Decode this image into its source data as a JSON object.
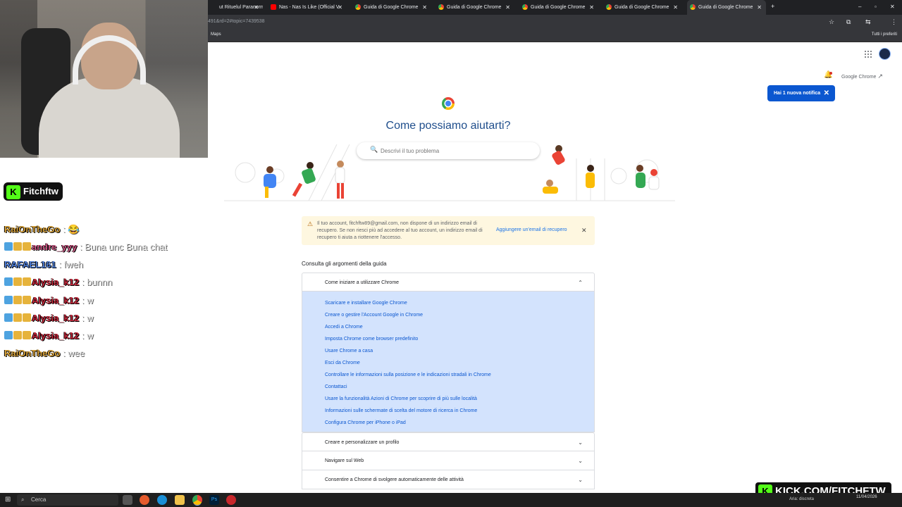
{
  "browser": {
    "tabs": [
      {
        "title": "ut Rituelul Paranormal",
        "favicon": "none"
      },
      {
        "title": "Nas - Nas Is Like (Official V",
        "favicon": "youtube"
      },
      {
        "title": "Guida di Google Chrome",
        "favicon": "google"
      },
      {
        "title": "Guida di Google Chrome",
        "favicon": "google"
      },
      {
        "title": "Guida di Google Chrome",
        "favicon": "google"
      },
      {
        "title": "Guida di Google Chrome",
        "favicon": "google"
      },
      {
        "title": "Guida di Google Chrome",
        "favicon": "google",
        "active": true
      }
    ],
    "url": "491&rd=2#topic=7439538",
    "bookmarks": {
      "left": "Maps",
      "right": "Tutti i preferiti"
    }
  },
  "overlay": {
    "streamer": "Fitchftw",
    "kick_url": "KICK.COM/FITCHFTW",
    "chat": [
      {
        "user": "RaiOnTheGo",
        "msg": "😂",
        "color": "#d8a23a",
        "badges": 0
      },
      {
        "user": "andre_yyy",
        "msg": "Buna unc Buna chat",
        "color": "#d45c8a",
        "badges": 3
      },
      {
        "user": "RAFAEL161",
        "msg": "fweh",
        "color": "#4f7fd9",
        "badges": 0
      },
      {
        "user": "Alysia_k12",
        "msg": "bunnn",
        "color": "#c8283c",
        "badges": 3
      },
      {
        "user": "Alysia_k12",
        "msg": "w",
        "color": "#c8283c",
        "badges": 3
      },
      {
        "user": "Alysia_k12",
        "msg": "w",
        "color": "#c8283c",
        "badges": 3
      },
      {
        "user": "Alysia_k12",
        "msg": "w",
        "color": "#c8283c",
        "badges": 3
      },
      {
        "user": "RaiOnTheGo",
        "msg": "wee",
        "color": "#d8a23a",
        "badges": 0
      }
    ]
  },
  "header": {
    "product_link": "Google Chrome",
    "notification": "Hai 1 nuova notifica"
  },
  "hero": {
    "title": "Come possiamo aiutarti?",
    "search_placeholder": "Descrivi il tuo problema"
  },
  "alert": {
    "text": "Il tuo account, fitchftw89@gmail.com, non dispone di un indirizzo email di recupero. Se non riesci più ad accedere al tuo account, un indirizzo email di recupero ti aiuta a riottenere l'accesso.",
    "link": "Aggiungere un'email di recupero"
  },
  "topics": {
    "heading": "Consulta gli argomenti della guida",
    "expanded": {
      "label": "Come iniziare a utilizzare Chrome",
      "items": [
        "Scaricare e installare Google Chrome",
        "Creare o gestire l'Account Google in Chrome",
        "Accedi a Chrome",
        "Imposta Chrome come browser predefinito",
        "Usare Chrome a casa",
        "Esci da Chrome",
        "Controllare le informazioni sulla posizione e le indicazioni stradali in Chrome",
        "Contattaci",
        "Usare la funzionalità Azioni di Chrome per scoprire di più sulle località",
        "Informazioni sulle schermate di scelta del motore di ricerca in Chrome",
        "Configura Chrome per iPhone o iPad"
      ]
    },
    "collapsed": [
      "Creare e personalizzare un profilo",
      "Navigare sul Web",
      "Consentire a Chrome di svolgere automaticamente delle attività"
    ]
  },
  "taskbar": {
    "search": "Cerca",
    "weather": "Aria: discreta",
    "date": "11/04/2026"
  }
}
